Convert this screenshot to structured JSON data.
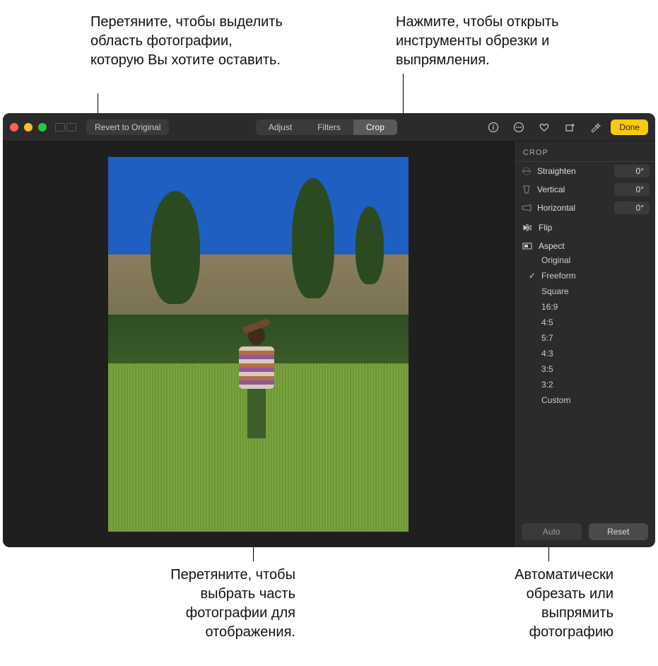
{
  "callouts": {
    "top_left": "Перетяните, чтобы выделить область фотографии, которую Вы хотите оставить.",
    "top_right": "Нажмите, чтобы открыть инструменты обрезки и выпрямления.",
    "bottom_left": "Перетяните, чтобы выбрать часть фотографии для отображения.",
    "bottom_right": "Автоматически обрезать или выпрямить фотографию"
  },
  "toolbar": {
    "revert": "Revert to Original",
    "tabs": {
      "adjust": "Adjust",
      "filters": "Filters",
      "crop": "Crop"
    },
    "done": "Done"
  },
  "panel": {
    "title": "CROP",
    "straighten": {
      "label": "Straighten",
      "value": "0°"
    },
    "vertical": {
      "label": "Vertical",
      "value": "0°"
    },
    "horizontal": {
      "label": "Horizontal",
      "value": "0°"
    },
    "flip": "Flip",
    "aspect": "Aspect",
    "aspect_items": [
      "Original",
      "Freeform",
      "Square",
      "16:9",
      "4:5",
      "5:7",
      "4:3",
      "3:5",
      "3:2",
      "Custom"
    ],
    "aspect_selected_index": 1,
    "auto": "Auto",
    "reset": "Reset"
  }
}
